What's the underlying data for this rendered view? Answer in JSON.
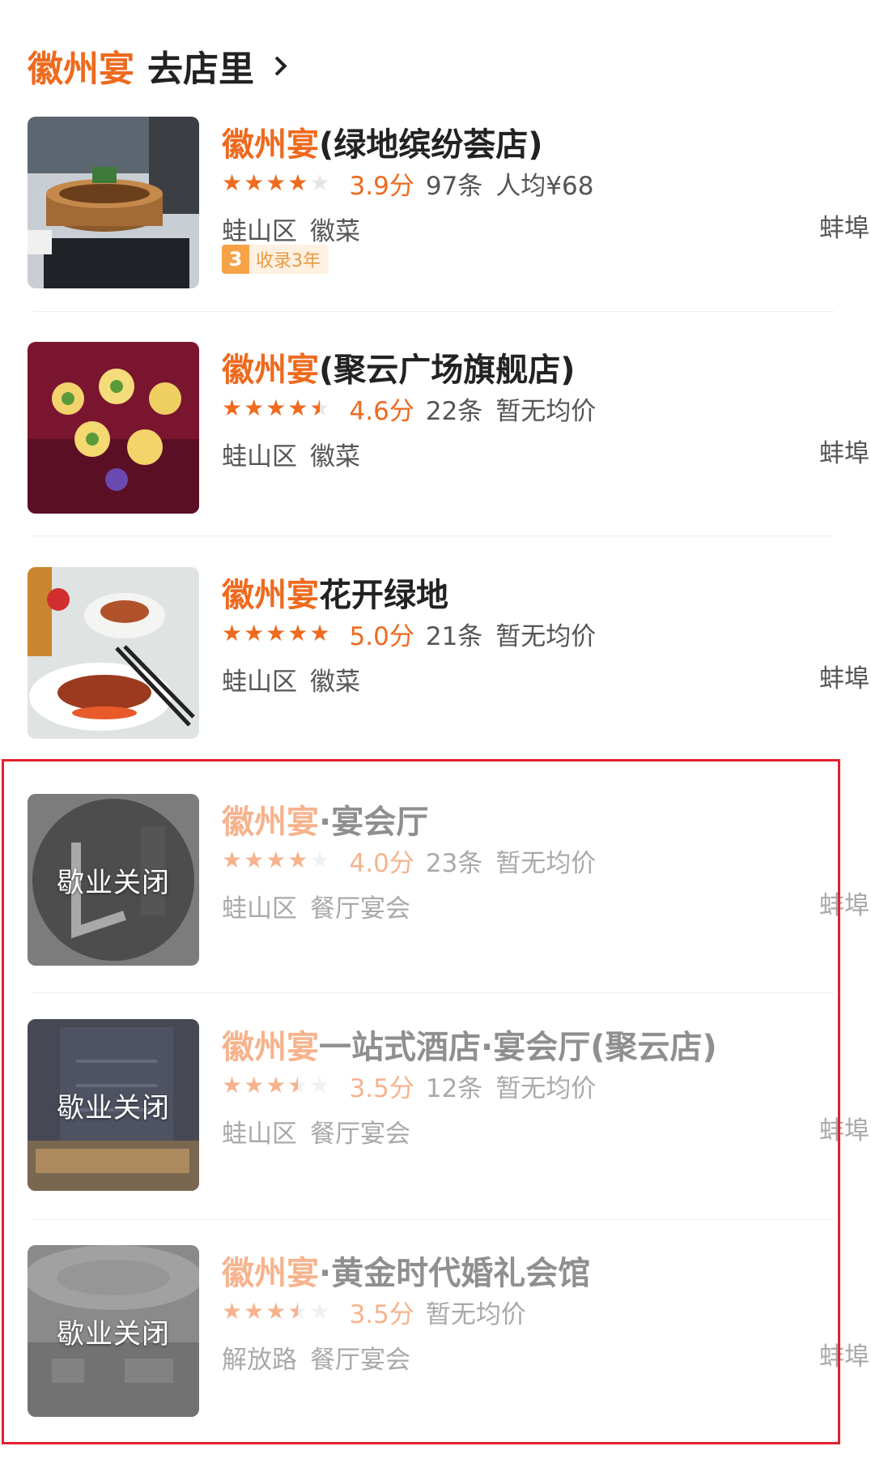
{
  "header": {
    "brand": "徽州宴",
    "link": "去店里"
  },
  "colors": {
    "accent": "#ee6a1e",
    "highlight_border": "#e3202e"
  },
  "shops": [
    {
      "brand": "徽州宴",
      "name_rest": "(绿地缤纷荟店)",
      "stars": [
        1,
        1,
        1,
        1,
        0
      ],
      "score": "3.9分",
      "reviews": "97条",
      "price": "人均¥68",
      "district": "蛙山区",
      "category": "徽菜",
      "city": "蚌埠",
      "badge_num": "3",
      "badge_text": "收录3年",
      "closed": false
    },
    {
      "brand": "徽州宴",
      "name_rest": "(聚云广场旗舰店)",
      "stars": [
        1,
        1,
        1,
        1,
        0.5
      ],
      "score": "4.6分",
      "reviews": "22条",
      "price": "暂无均价",
      "district": "蛙山区",
      "category": "徽菜",
      "city": "蚌埠",
      "closed": false
    },
    {
      "brand": "徽州宴",
      "name_rest": "花开绿地",
      "stars": [
        1,
        1,
        1,
        1,
        1
      ],
      "score": "5.0分",
      "reviews": "21条",
      "price": "暂无均价",
      "district": "蛙山区",
      "category": "徽菜",
      "city": "蚌埠",
      "closed": false
    },
    {
      "brand": "徽州宴",
      "name_rest": "·宴会厅",
      "stars": [
        1,
        1,
        1,
        1,
        0
      ],
      "score": "4.0分",
      "reviews": "23条",
      "price": "暂无均价",
      "district": "蛙山区",
      "category": "餐厅宴会",
      "city": "蚌埠",
      "closed": true,
      "closed_label": "歇业关闭"
    },
    {
      "brand": "徽州宴",
      "name_rest": "一站式酒店·宴会厅(聚云店)",
      "stars": [
        1,
        1,
        1,
        0.5,
        0
      ],
      "score": "3.5分",
      "reviews": "12条",
      "price": "暂无均价",
      "district": "蛙山区",
      "category": "餐厅宴会",
      "city": "蚌埠",
      "closed": true,
      "closed_label": "歇业关闭"
    },
    {
      "brand": "徽州宴",
      "name_rest": "·黄金时代婚礼会馆",
      "stars": [
        1,
        1,
        1,
        0.5,
        0
      ],
      "score": "3.5分",
      "reviews": "",
      "price": "暂无均价",
      "district": "解放路",
      "category": "餐厅宴会",
      "city": "蚌埠",
      "closed": true,
      "closed_label": "歇业关闭"
    }
  ]
}
